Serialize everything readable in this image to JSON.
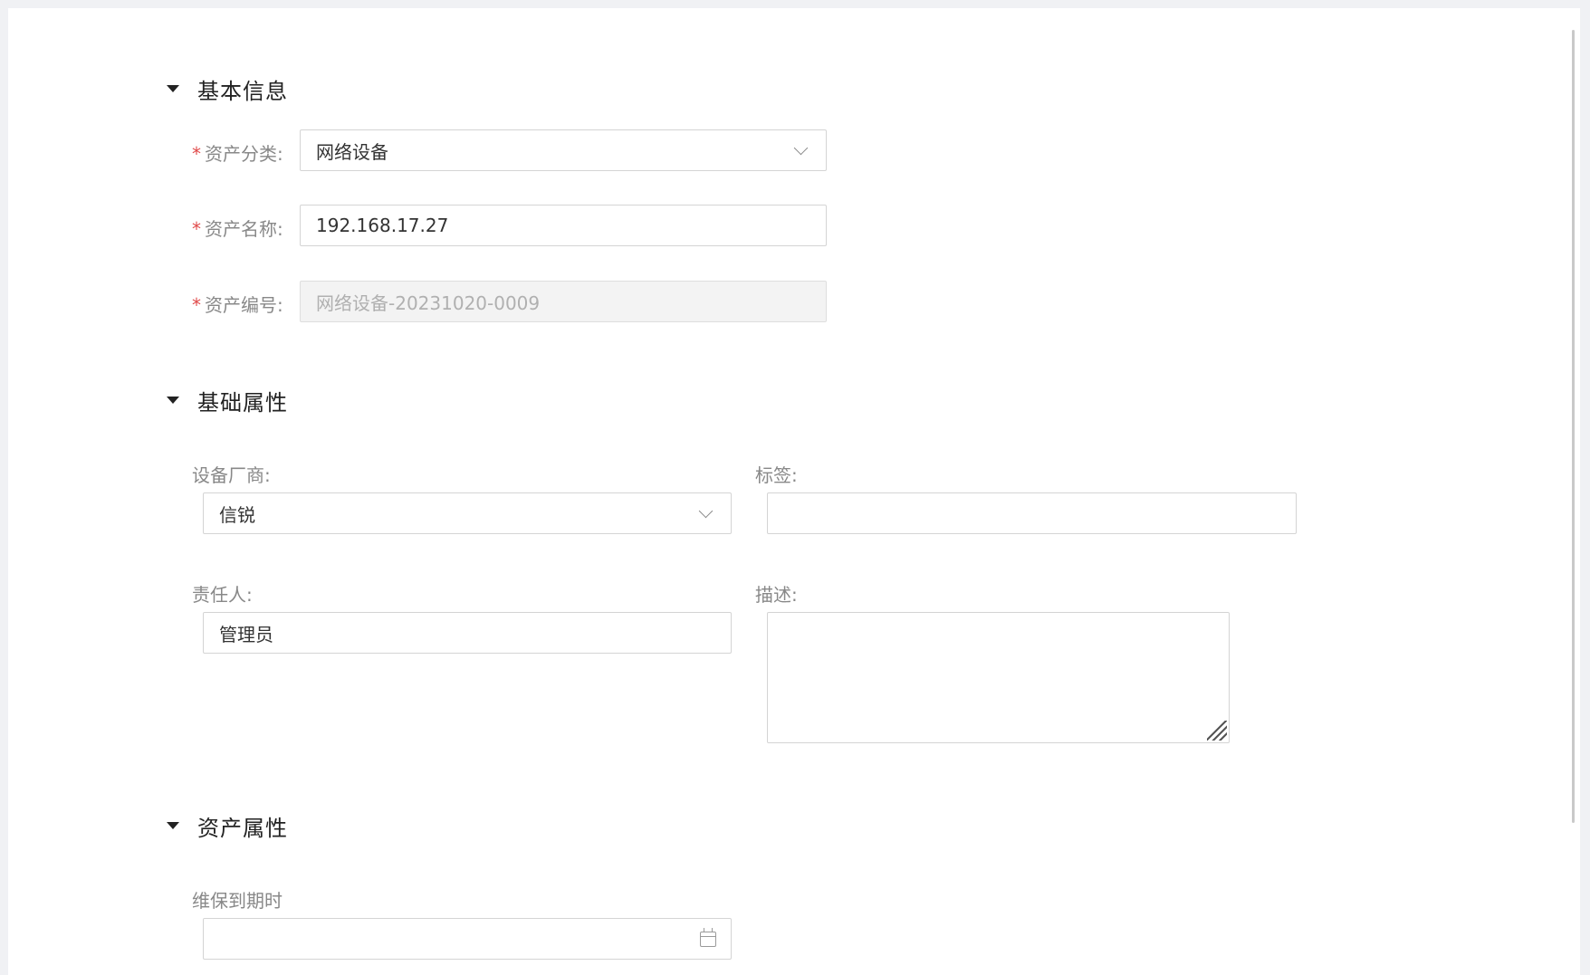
{
  "sections": {
    "basic_info": {
      "title": "基本信息"
    },
    "base_attrs": {
      "title": "基础属性"
    },
    "asset_attrs": {
      "title": "资产属性"
    }
  },
  "fields": {
    "asset_category": {
      "label": "资产分类:",
      "value": "网络设备"
    },
    "asset_name": {
      "label": "资产名称:",
      "value": "192.168.17.27"
    },
    "asset_number": {
      "label": "资产编号:",
      "value": "网络设备-20231020-0009"
    },
    "vendor": {
      "label": "设备厂商:",
      "value": "信锐"
    },
    "tags": {
      "label": "标签:",
      "value": ""
    },
    "owner": {
      "label": "责任人:",
      "value": "管理员"
    },
    "description": {
      "label": "描述:",
      "value": ""
    },
    "warranty_expiry": {
      "label": "维保到期时",
      "value": ""
    }
  },
  "required_mark": "*",
  "icons": {
    "section_toggle": "caret-down-icon",
    "select": "chevron-down-icon",
    "date": "calendar-icon"
  }
}
